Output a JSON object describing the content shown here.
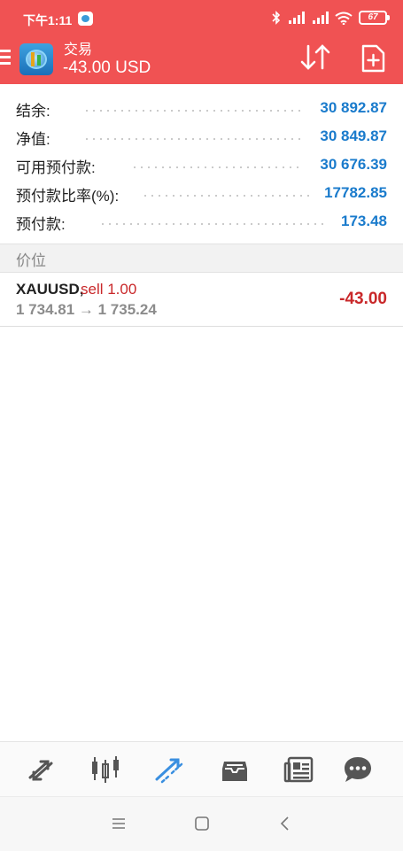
{
  "status_bar": {
    "time": "下午1:11",
    "battery": "67",
    "icons": [
      "chat-bubble-icon",
      "bluetooth-icon",
      "signal-icon",
      "signal-icon",
      "wifi-icon",
      "battery-icon"
    ]
  },
  "header": {
    "title": "交易",
    "amount": "-43.00 USD",
    "actions": [
      "menu-icon",
      "sort-icon",
      "new-order-icon"
    ]
  },
  "summary": [
    {
      "label": "结余:",
      "value": "30 892.87"
    },
    {
      "label": "净值:",
      "value": "30 849.87"
    },
    {
      "label": "可用预付款:",
      "value": "30 676.39"
    },
    {
      "label": "预付款比率(%):",
      "value": "17782.85"
    },
    {
      "label": "预付款:",
      "value": "173.48"
    }
  ],
  "section_title": "价位",
  "positions": [
    {
      "symbol": "XAUUSD,",
      "side": "sell 1.00",
      "prices": "1 734.81 → 1 735.24",
      "profit": "-43.00"
    }
  ],
  "bottom_nav": [
    "quotes-icon",
    "chart-icon",
    "trade-icon",
    "history-icon",
    "news-icon",
    "chat-icon"
  ],
  "system_nav": [
    "menu-icon",
    "home-icon",
    "back-icon"
  ],
  "colors": {
    "header": "#f05253",
    "value_blue": "#1a7bcc",
    "loss_red": "#c9282a",
    "nav_active": "#3a8fe0"
  }
}
